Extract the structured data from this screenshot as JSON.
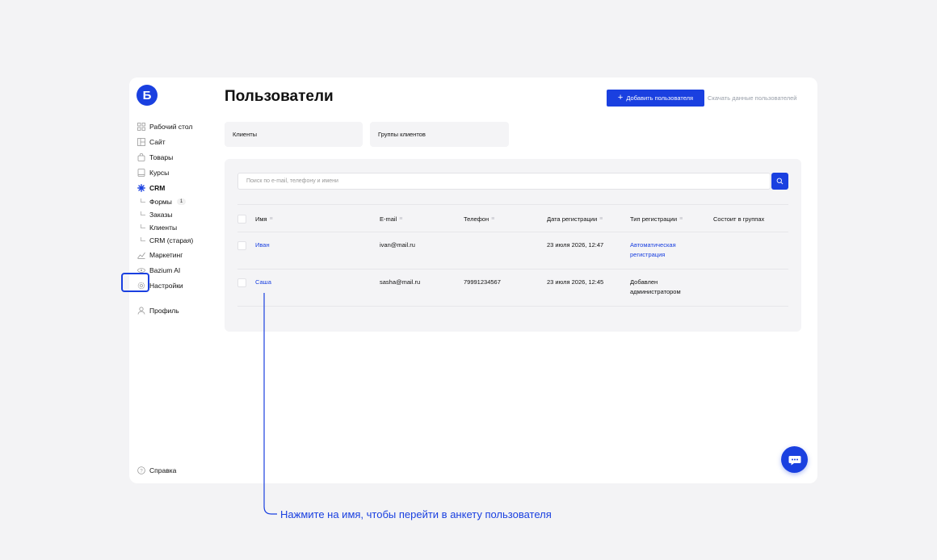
{
  "app": {
    "logo_letter": "Б"
  },
  "sidebar": {
    "items": [
      {
        "label": "Рабочий стол",
        "icon": "dashboard-icon"
      },
      {
        "label": "Сайт",
        "icon": "site-icon"
      },
      {
        "label": "Товары",
        "icon": "bag-icon"
      },
      {
        "label": "Курсы",
        "icon": "book-icon"
      },
      {
        "label": "CRM",
        "icon": "crm-icon",
        "active": true
      }
    ],
    "crm_sub": [
      {
        "label": "Формы",
        "badge": "1"
      },
      {
        "label": "Заказы"
      },
      {
        "label": "Клиенты"
      },
      {
        "label": "CRM (старая)"
      }
    ],
    "items_after": [
      {
        "label": "Маркетинг",
        "icon": "marketing-icon"
      },
      {
        "label": "Bazium AI",
        "icon": "ai-icon"
      },
      {
        "label": "Настройки",
        "icon": "gear-icon"
      }
    ],
    "profile": "Профиль",
    "help": "Справка"
  },
  "header": {
    "title": "Пользователи",
    "add_button": "Добавить пользователя",
    "download_link": "Скачать данные пользователей"
  },
  "tabs": [
    "Клиенты",
    "Группы клиентов"
  ],
  "search": {
    "placeholder": "Поиск по e-mail, телефону и имени"
  },
  "table": {
    "columns": [
      "Имя",
      "E-mail",
      "Телефон",
      "Дата регистрации",
      "Тип регистрации",
      "Состоит в группах"
    ],
    "rows": [
      {
        "name": "Иван",
        "email": "ivan@mail.ru",
        "phone": "",
        "date": "23 июля 2026, 12:47",
        "type_line1": "Автоматическая",
        "type_line2": "регистрация",
        "type_is_link": true,
        "groups": ""
      },
      {
        "name": "Саша",
        "email": "sasha@mail.ru",
        "phone": "79991234567",
        "date": "23 июля 2026, 12:45",
        "type_line1": "Добавлен",
        "type_line2": "администратором",
        "type_is_link": false,
        "groups": ""
      }
    ]
  },
  "annotation": {
    "text": "Нажмите на имя, чтобы перейти в анкету пользователя"
  },
  "colors": {
    "accent": "#1a40e0",
    "panel": "#f4f4f6",
    "background": "#f3f3f5"
  }
}
